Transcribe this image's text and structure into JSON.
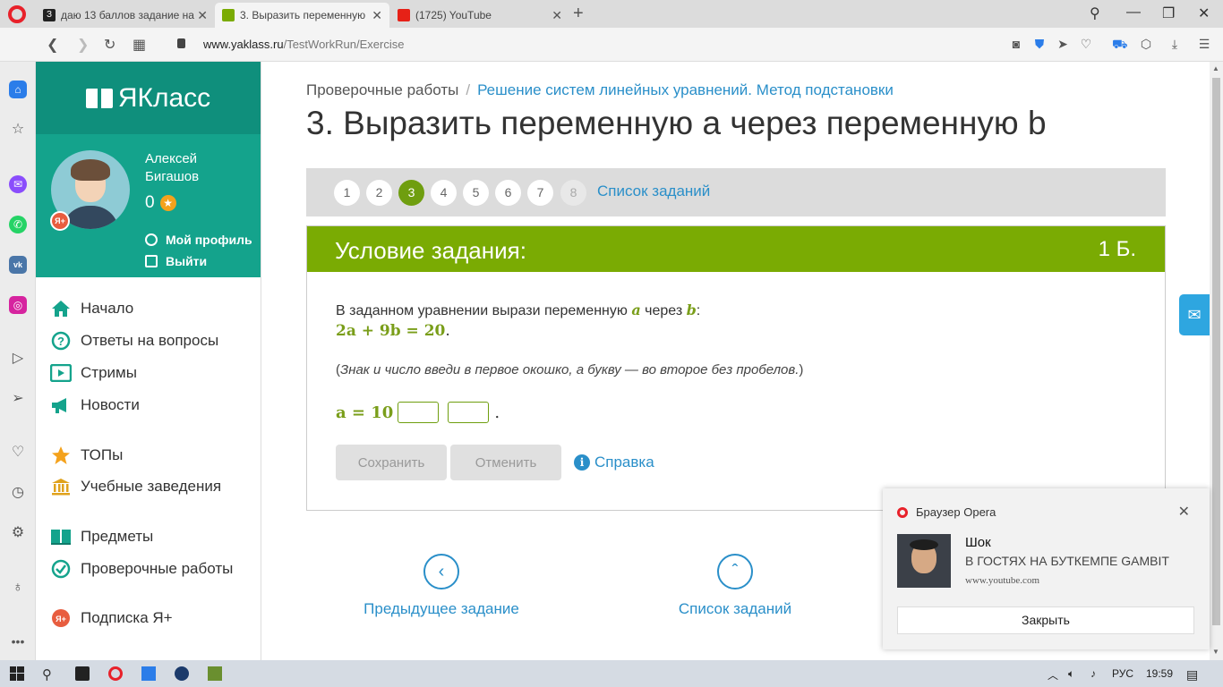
{
  "browser": {
    "tabs": [
      {
        "title": "даю 13 баллов задание на",
        "active": false
      },
      {
        "title": "3. Выразить переменную",
        "active": true
      },
      {
        "title": "(1725) YouTube",
        "active": false
      }
    ],
    "url_host": "www.yaklass.ru",
    "url_path": "/TestWorkRun/Exercise"
  },
  "site": {
    "logo": "ЯКласс",
    "user": {
      "name": "Алексей Бигашов",
      "points": "0",
      "profile_link": "Мой профиль",
      "logout_link": "Выйти",
      "badge": "Я+"
    },
    "menu": [
      {
        "label": "Начало",
        "icon": "home-icon"
      },
      {
        "label": "Ответы на вопросы",
        "icon": "question-icon"
      },
      {
        "label": "Стримы",
        "icon": "play-icon"
      },
      {
        "label": "Новости",
        "icon": "megaphone-icon"
      },
      {
        "label": "ТОПы",
        "icon": "star-icon"
      },
      {
        "label": "Учебные заведения",
        "icon": "institution-icon"
      },
      {
        "label": "Предметы",
        "icon": "books-icon"
      },
      {
        "label": "Проверочные работы",
        "icon": "check-icon"
      },
      {
        "label": "Подписка Я+",
        "icon": "ya-plus-icon"
      }
    ]
  },
  "main": {
    "breadcrumb_root": "Проверочные работы",
    "breadcrumb_sep": "/",
    "breadcrumb_topic": "Решение систем линейных уравнений. Метод подстановки",
    "title": "3. Выразить переменную а через переменную b",
    "pager": {
      "pages": [
        "1",
        "2",
        "3",
        "4",
        "5",
        "6",
        "7",
        "8"
      ],
      "current": "3",
      "list_link": "Список заданий"
    },
    "task": {
      "header": "Условие задания:",
      "points": "1 Б.",
      "text_before": "В заданном уравнении вырази переменную ",
      "var_a": "a",
      "text_mid": " через ",
      "var_b": "b",
      "text_after": ":",
      "equation": "2a + 9b = 20",
      "equation_end": ".",
      "hint_open": "(",
      "hint": "Знак и число введи в первое окошко, а букву — во второе без пробелов.",
      "hint_close": ")",
      "answer_prefix": "a = 10",
      "answer_suffix": ".",
      "input1_value": "",
      "input2_value": "",
      "save_label": "Сохранить",
      "cancel_label": "Отменить",
      "help_label": "Справка"
    },
    "prev_task": "Предыдущее задание",
    "task_list": "Список заданий"
  },
  "notification": {
    "source": "Браузер Opera",
    "title": "Шок",
    "subtitle": "В ГОСТЯХ НА БУТКЕМПЕ GAMBIT",
    "url": "www.youtube.com",
    "close_label": "Закрыть"
  },
  "taskbar": {
    "lang": "РУС",
    "time": "19:59"
  },
  "colors": {
    "brand_teal": "#0f8f7c",
    "profile_teal": "#14a38c",
    "task_green": "#7aab03",
    "link_blue": "#2a8fc9"
  }
}
